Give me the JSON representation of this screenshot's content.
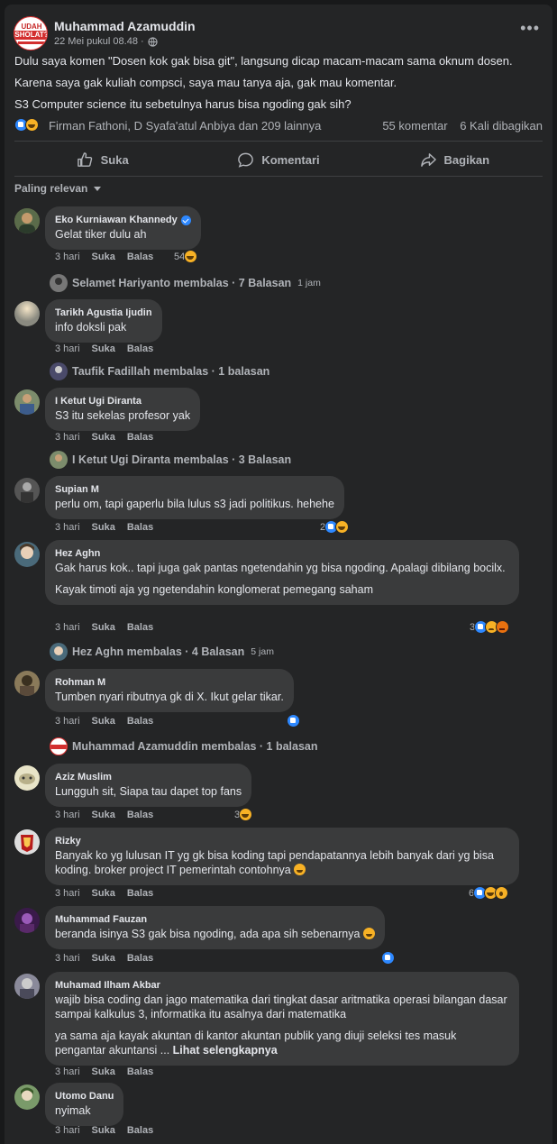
{
  "post": {
    "author": "Muhammad Azamuddin",
    "logo_line1": "UDAH",
    "logo_line2": "SHOLAT?",
    "time": "22 Mei pukul 08.48 · ",
    "paragraphs": [
      "Dulu saya komen \"Dosen kok gak bisa git\", langsung dicap macam-macam sama oknum dosen.",
      "Karena saya gak kuliah compsci,  saya mau tanya aja, gak mau komentar.",
      "S3 Computer science itu sebetulnya harus bisa ngoding gak sih?"
    ],
    "reactors": "Firman Fathoni, D Syafa'atul Anbiya dan 209 lainnya",
    "comments_count": "55 komentar",
    "shares_count": "6 Kali dibagikan"
  },
  "actions": {
    "like": "Suka",
    "comment": "Komentari",
    "share": "Bagikan"
  },
  "sort_label": "Paling relevan",
  "comment_meta": {
    "time": "3 hari",
    "like": "Suka",
    "reply": "Balas"
  },
  "comments": [
    {
      "name": "Eko Kurniawan Khannedy",
      "text": "Gelat tiker dulu ah",
      "reactions": "54",
      "reply": {
        "name": "Selamet Hariyanto membalas · 7 Balasan",
        "time": "1 jam"
      }
    },
    {
      "name": "Tarikh Agustia Ijudin",
      "text": "info doksli pak",
      "reactions": "",
      "reply": {
        "name": "Taufik Fadillah membalas · 1 balasan",
        "time": ""
      }
    },
    {
      "name": "I Ketut Ugi Diranta",
      "text": "S3 itu sekelas profesor yak",
      "reactions": "",
      "reply": {
        "name": "I Ketut Ugi Diranta membalas · 3 Balasan",
        "time": ""
      }
    },
    {
      "name": "Supian M",
      "text": "perlu om, tapi gaperlu bila lulus s3 jadi politikus. hehehe",
      "reactions": "2",
      "reply": null
    },
    {
      "name": "Hez Aghn",
      "text": "Gak harus kok.. tapi juga gak pantas ngetendahin yg bisa ngoding. Apalagi dibilang bocilx.",
      "text2": "Kayak timoti aja yg ngetendahin konglomerat pemegang saham",
      "reactions": "3",
      "reply": {
        "name": "Hez Aghn membalas · 4 Balasan",
        "time": "5 jam"
      }
    },
    {
      "name": "Rohman M",
      "text": "Tumben nyari ributnya gk di X. Ikut gelar tikar.",
      "reactions": "",
      "reply": {
        "name": "Muhammad Azamuddin membalas · 1 balasan",
        "time": ""
      }
    },
    {
      "name": "Aziz Muslim",
      "text": "Lungguh sit, Siapa tau dapet top fans",
      "reactions": "3",
      "reply": null
    },
    {
      "name": "Rizky",
      "text": "Banyak ko yg lulusan IT yg gk bisa koding tapi pendapatannya lebih banyak dari yg bisa koding. broker project IT pemerintah contohnya",
      "reactions": "6",
      "reply": null
    },
    {
      "name": "Muhammad Fauzan",
      "text": "beranda isinya S3 gak bisa ngoding, ada apa sih sebenarnya",
      "reactions": "",
      "reply": null
    },
    {
      "name": "Muhamad Ilham Akbar",
      "text": "wajib bisa coding dan jago matematika dari tingkat dasar aritmatika operasi bilangan dasar sampai kalkulus 3, informatika itu asalnya dari matematika",
      "text2": "ya sama aja kayak akuntan di kantor akuntan publik yang diuji seleksi tes masuk pengantar akuntansi ...",
      "see_more": "Lihat selengkapnya",
      "reactions": "",
      "reply": null
    },
    {
      "name": "Utomo Danu",
      "text": "nyimak",
      "reactions": "",
      "reply": null
    }
  ]
}
